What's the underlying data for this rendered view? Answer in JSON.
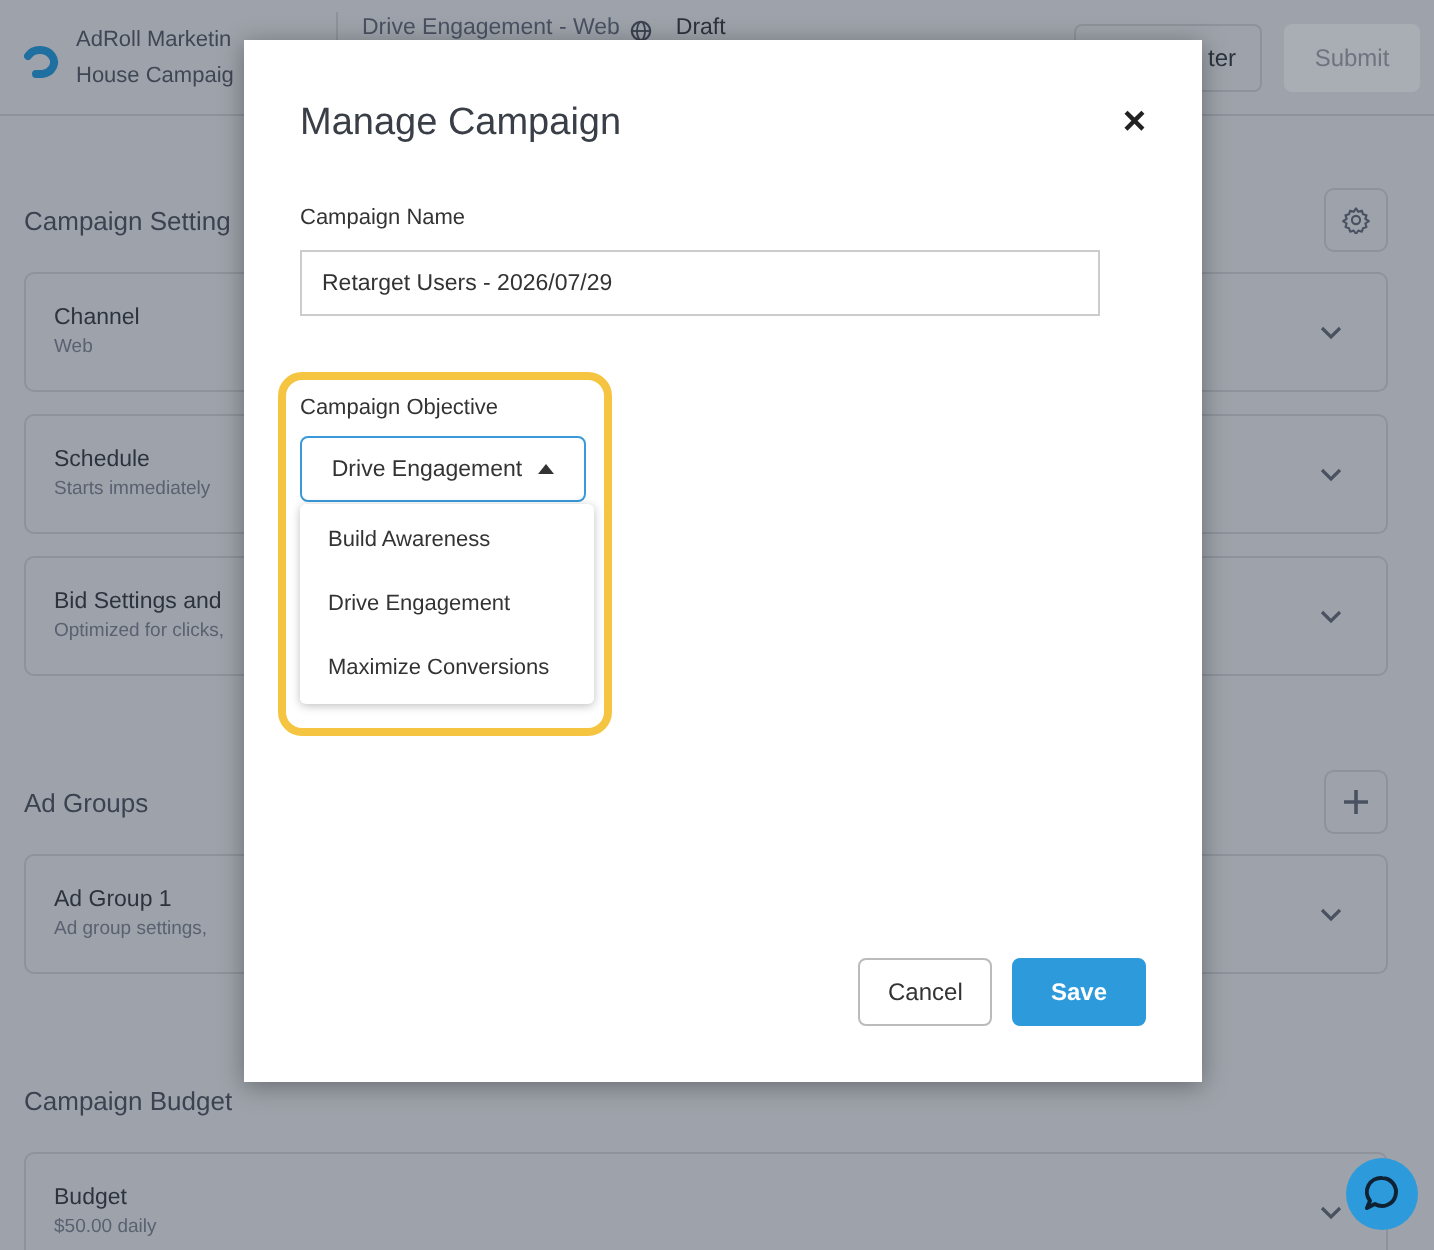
{
  "header": {
    "account": "AdRoll Marketin",
    "campaign": "House Campaig",
    "name": "Drive Engagement - Web",
    "status": "Draft",
    "buttons": [
      {
        "label": "ter",
        "disabled": false
      },
      {
        "label": "Submit",
        "disabled": true
      }
    ]
  },
  "sections": [
    {
      "title": "Campaign Setting",
      "kind": "settings",
      "cards": [
        {
          "title": "Channel",
          "subtitle": "Web"
        },
        {
          "title": "Schedule",
          "subtitle": "Starts immediately"
        },
        {
          "title": "Bid Settings and",
          "subtitle": "Optimized for clicks,"
        }
      ]
    },
    {
      "title": "Ad Groups",
      "kind": "add",
      "cards": [
        {
          "title": "Ad Group 1",
          "subtitle": "Ad group settings,"
        }
      ]
    },
    {
      "title": "Campaign Budget",
      "kind": "plain",
      "cards": [
        {
          "title": "Budget",
          "subtitle": "$50.00 daily"
        }
      ]
    }
  ],
  "modal": {
    "title": "Manage Campaign",
    "close": "×",
    "name_label": "Campaign Name",
    "name_value": "Retarget Users - 2026/07/29",
    "objective_label": "Campaign Objective",
    "objective_value": "Drive Engagement",
    "expanded": true,
    "options": [
      "Build Awareness",
      "Drive Engagement",
      "Maximize Conversions"
    ],
    "buttons": [
      {
        "label": "Cancel",
        "kind": "secondary"
      },
      {
        "label": "Save",
        "kind": "primary"
      }
    ]
  }
}
